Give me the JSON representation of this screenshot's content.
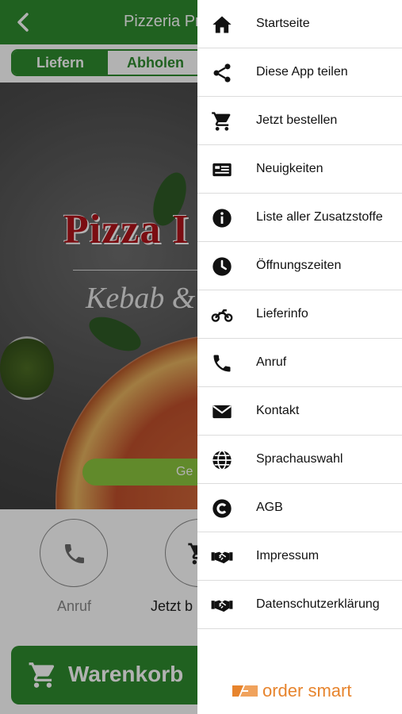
{
  "topbar": {
    "title": "Pizzeria Pr"
  },
  "order_mode": {
    "tabs": [
      {
        "label": "Liefern",
        "active": true
      },
      {
        "label": "Abholen",
        "active": false
      }
    ]
  },
  "hero": {
    "logo_text": "Pizza I",
    "logo_subtext": "Kebab &",
    "location_button": "Ge"
  },
  "actions": {
    "call_label": "Anruf",
    "order_label": "Jetzt b"
  },
  "cart": {
    "label": "Warenkorb"
  },
  "menu": {
    "items": [
      {
        "label": "Startseite",
        "icon": "home-icon"
      },
      {
        "label": "Diese App teilen",
        "icon": "share-icon"
      },
      {
        "label": "Jetzt bestellen",
        "icon": "cart-icon"
      },
      {
        "label": "Neuigkeiten",
        "icon": "newspaper-icon"
      },
      {
        "label": "Liste aller Zusatzstoffe",
        "icon": "info-icon"
      },
      {
        "label": "Öffnungszeiten",
        "icon": "clock-icon"
      },
      {
        "label": "Lieferinfo",
        "icon": "motorcycle-icon"
      },
      {
        "label": "Anruf",
        "icon": "phone-icon"
      },
      {
        "label": "Kontakt",
        "icon": "envelope-icon"
      },
      {
        "label": "Sprachauswahl",
        "icon": "globe-icon"
      },
      {
        "label": "AGB",
        "icon": "copyright-icon"
      },
      {
        "label": "Impressum",
        "icon": "handshake-icon"
      },
      {
        "label": "Datenschutzerklärung",
        "icon": "handshake-icon"
      }
    ]
  },
  "brand": {
    "text": "order smart"
  },
  "colors": {
    "primary": "#2e8b2e",
    "accent_green": "#8cc63e",
    "brand_orange": "#e7842d",
    "logo_red": "#b0141a"
  }
}
